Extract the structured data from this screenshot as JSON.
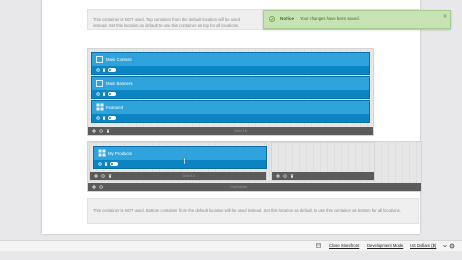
{
  "top_notice_box": {
    "text": "This container is NOT used. Top container from the default location will be used instead. Set this location as default to use this container as top for all locations."
  },
  "blocks": [
    {
      "title": "Main Content",
      "icon": "content-icon"
    },
    {
      "title": "Main Banners",
      "icon": "banner-icon"
    },
    {
      "title": "Featured",
      "icon": "cubes-icon"
    }
  ],
  "grid_labels": {
    "main_grid": "Grid 16",
    "product_grid": "Grid 10",
    "container": "Container"
  },
  "product_block": {
    "title": "My Products",
    "icon": "cubes-icon"
  },
  "bottom_notice_box": {
    "text": "This container is NOT used. Bottom container from the default location will be used instead. Set this location as default to use this container as bottom for all locations."
  },
  "notice": {
    "title": "Notice",
    "message": "Your changes have been saved.",
    "color": "#c7e3b5"
  },
  "bottom_bar": {
    "close_storefront": "Close Storefront",
    "development_mode": "Development Mode",
    "currency": "US Dollars ($)"
  },
  "colors": {
    "block_blue": "#2ea3dc",
    "block_dark_blue": "#0b84c3",
    "control_bar": "#5b5b5b"
  }
}
